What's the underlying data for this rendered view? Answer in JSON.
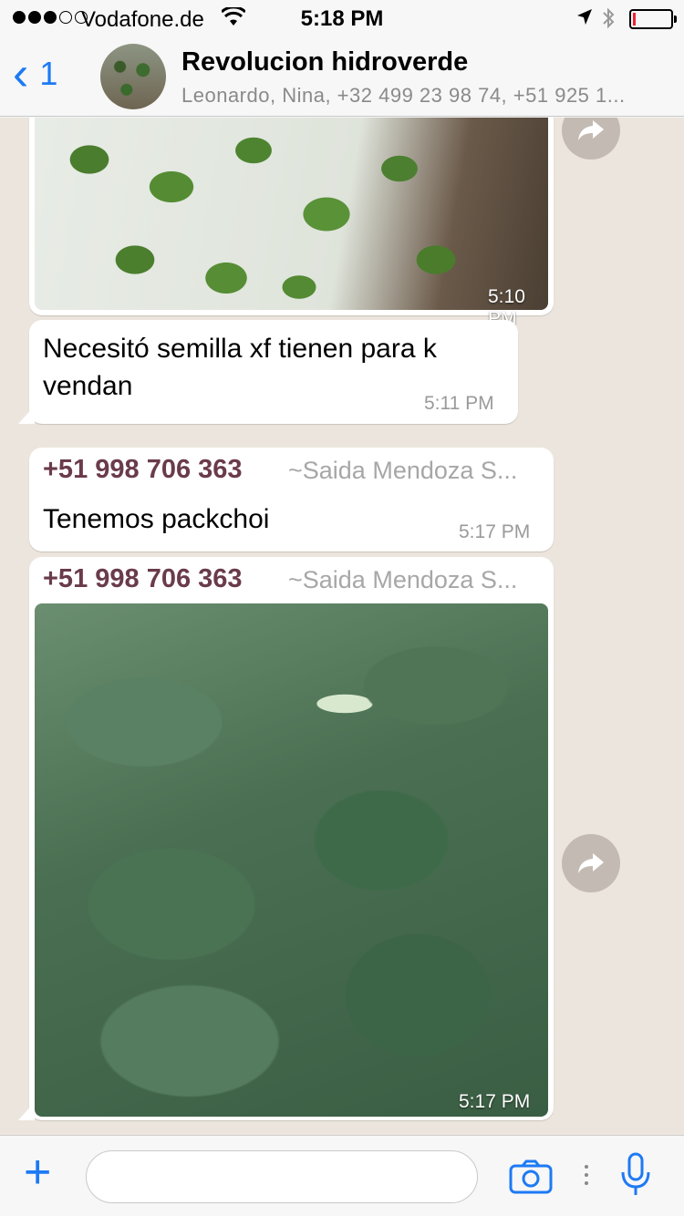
{
  "status_bar": {
    "carrier": "Vodafone.de",
    "time": "5:18 PM"
  },
  "header": {
    "back_count": "1",
    "title": "Revolucion hidroverde",
    "subtitle": "Leonardo, Nina, +32 499 23 98 74, +51 925 1..."
  },
  "messages": [
    {
      "type": "image",
      "time": "5:10 PM"
    },
    {
      "type": "text",
      "text": "Necesitó semilla xf tienen para k vendan",
      "time": "5:11 PM"
    },
    {
      "type": "text",
      "sender": "+51 998 706 363",
      "sender_name": "~Saida Mendoza S...",
      "text": "Tenemos packchoi",
      "time": "5:17 PM"
    },
    {
      "type": "image",
      "sender": "+51 998 706 363",
      "sender_name": "~Saida Mendoza S...",
      "time": "5:17 PM"
    }
  ],
  "colors": {
    "accent": "#1d7af4",
    "sender": "#6a3b4b",
    "chat_bg": "#ece5dd"
  }
}
